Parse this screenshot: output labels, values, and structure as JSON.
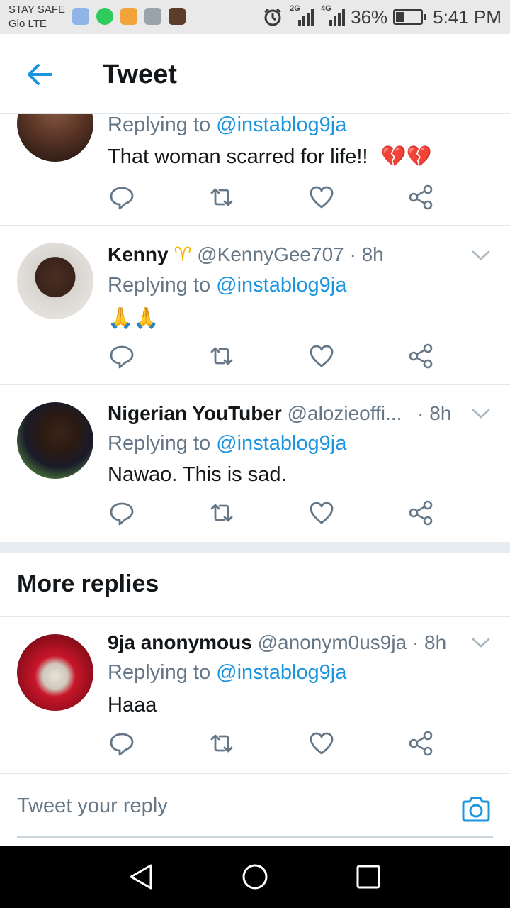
{
  "status_bar": {
    "carrier_line1": "STAY SAFE",
    "carrier_line2": "Glo LTE",
    "notification_icons": [
      "cyan-app-icon",
      "whatsapp-icon",
      "lock-app-icon",
      "gallery-icon",
      "contact-photo-icon"
    ],
    "alarm_icon": "alarm-icon",
    "network1": "2G",
    "network2": "4G",
    "battery": "36%",
    "battery_level": 0.36,
    "time": "5:41 PM"
  },
  "header": {
    "back_icon": "arrow-left-icon",
    "title": "Tweet"
  },
  "tweets": [
    {
      "name": "",
      "handle": "",
      "time": "",
      "replying_prefix": "Replying to",
      "replying_to": "@instablog9ja",
      "text": "That woman scarred for life!!",
      "emoji": "💔💔"
    },
    {
      "name": "Kenny",
      "name_emoji": "♈",
      "handle": "@KennyGee707",
      "time": "· 8h",
      "replying_prefix": "Replying to",
      "replying_to": "@instablog9ja",
      "text": "🙏🙏"
    },
    {
      "name": "Nigerian YouTuber",
      "handle": "@alozieoffi...",
      "time": "· 8h",
      "replying_prefix": "Replying to",
      "replying_to": "@instablog9ja",
      "text": "Nawao. This is sad."
    },
    {
      "name": "9ja anonymous",
      "handle": "@anonym0us9ja",
      "time": "· 8h",
      "replying_prefix": "Replying to",
      "replying_to": "@instablog9ja",
      "text": "Haaa"
    }
  ],
  "action_icons": [
    "reply-icon",
    "retweet-icon",
    "like-icon",
    "share-icon"
  ],
  "more_replies": {
    "title": "More replies"
  },
  "composer": {
    "placeholder": "Tweet your reply",
    "camera_icon": "camera-icon"
  },
  "nav_bar": {
    "icons": [
      "back-triangle-icon",
      "home-circle-icon",
      "recents-square-icon"
    ]
  },
  "colors": {
    "accent": "#1b95e0",
    "text_primary": "#14171a",
    "text_secondary": "#657786",
    "divider": "#e1e8ed"
  }
}
